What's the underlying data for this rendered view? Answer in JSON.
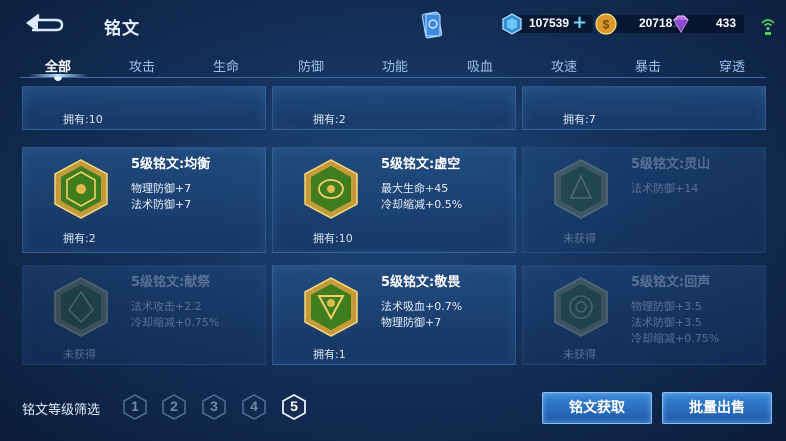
{
  "header": {
    "title": "铭文",
    "currencies": [
      {
        "icon": "diamond-icon",
        "value": "107539"
      },
      {
        "icon": "gold-coin-icon",
        "value": "207181"
      },
      {
        "icon": "gem-icon",
        "value": "433"
      }
    ]
  },
  "tabs": [
    "全部",
    "攻击",
    "生命",
    "防御",
    "功能",
    "吸血",
    "攻速",
    "暴击",
    "穿透"
  ],
  "cards": [
    {
      "name": "",
      "attrs": [],
      "own": "拥有:10",
      "owned": true,
      "color": "#3f7d1e"
    },
    {
      "name": "",
      "attrs": [],
      "own": "拥有:2",
      "owned": true,
      "color": "#3f7d1e"
    },
    {
      "name": "",
      "attrs": [],
      "own": "拥有:7",
      "owned": true,
      "color": "#3f7d1e"
    },
    {
      "name": "5级铭文:均衡",
      "attrs": [
        "物理防御+7",
        "法术防御+7"
      ],
      "own": "拥有:2",
      "owned": true,
      "color": "#3f7d1e"
    },
    {
      "name": "5级铭文:虚空",
      "attrs": [
        "最大生命+45",
        "冷却缩减+0.5%"
      ],
      "own": "拥有:10",
      "owned": true,
      "color": "#3f7d1e"
    },
    {
      "name": "5级铭文:灵山",
      "attrs": [
        "法术防御+14"
      ],
      "own": "未获得",
      "owned": false,
      "color": "#2e5a3a"
    },
    {
      "name": "5级铭文:献祭",
      "attrs": [
        "法术攻击+2.2",
        "冷却缩减+0.75%"
      ],
      "own": "未获得",
      "owned": false,
      "color": "#2e5a3a"
    },
    {
      "name": "5级铭文:敬畏",
      "attrs": [
        "法术吸血+0.7%",
        "物理防御+7"
      ],
      "own": "拥有:1",
      "owned": true,
      "color": "#3f7d1e"
    },
    {
      "name": "5级铭文:回声",
      "attrs": [
        "物理防御+3.5",
        "法术防御+3.5",
        "冷却缩减+0.75%"
      ],
      "own": "未获得",
      "owned": false,
      "color": "#2e5a3a"
    }
  ],
  "bottom": {
    "filter_label": "铭文等级筛选",
    "levels": [
      "1",
      "2",
      "3",
      "4",
      "5"
    ],
    "active_level": "5",
    "acquire_button": "铭文获取",
    "sell_button": "批量出售"
  },
  "colors": {
    "accent": "#3a86d6",
    "background": "#13315a"
  }
}
